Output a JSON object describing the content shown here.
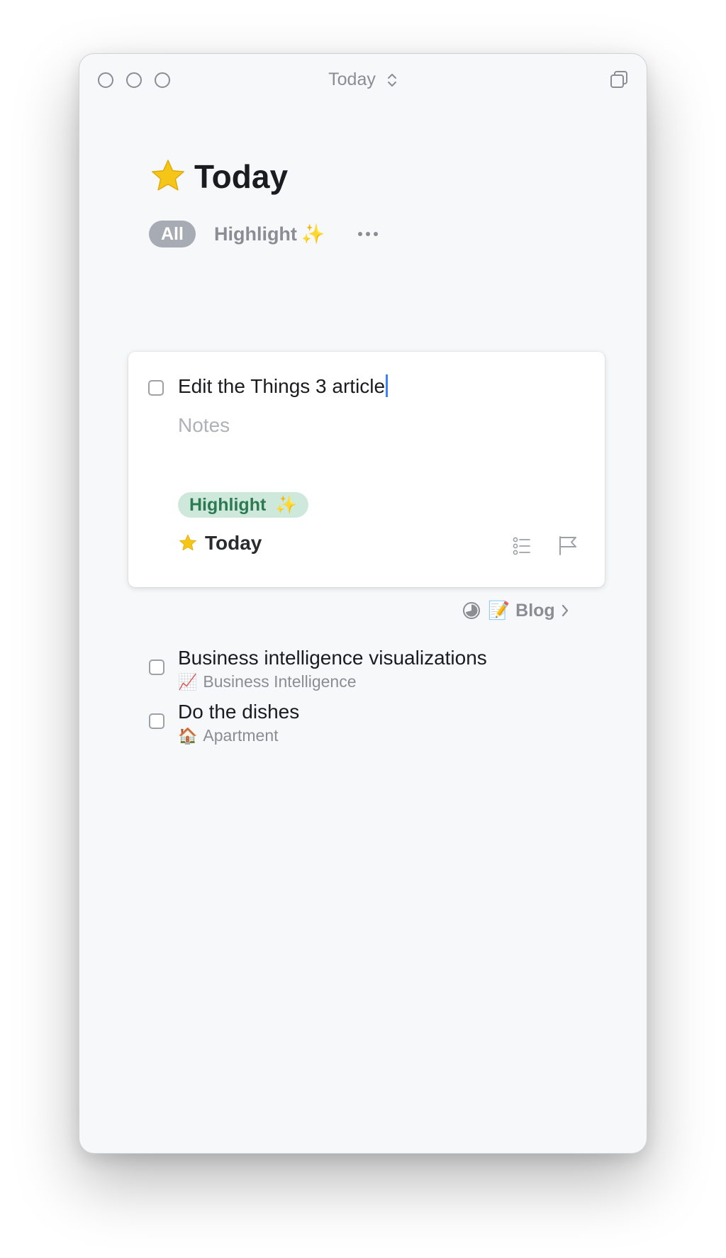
{
  "window": {
    "title": "Today"
  },
  "page": {
    "title": "Today",
    "icon": "star-icon"
  },
  "tag_filter": {
    "all_label": "All",
    "highlight_label": "Highlight",
    "highlight_emoji": "✨",
    "more_icon": "ellipsis-icon"
  },
  "editing_task": {
    "title": "Edit the Things 3 article",
    "notes_placeholder": "Notes",
    "tag_label": "Highlight",
    "tag_emoji": "✨",
    "when_label": "Today",
    "checklist_icon": "checklist-icon",
    "deadline_icon": "flag-icon"
  },
  "project_link": {
    "progress_icon": "project-progress-icon",
    "emoji": "📝",
    "label": "Blog",
    "chevron_icon": "chevron-right-icon"
  },
  "tasks": [
    {
      "title": "Business intelligence visualizations",
      "area_emoji": "📈",
      "area": "Business Intelligence"
    },
    {
      "title": "Do the dishes",
      "area_emoji": "🏠",
      "area": "Apartment"
    }
  ],
  "colors": {
    "accent": "#3b82f6",
    "star": "#f5c518",
    "tag_bg": "#cfe8dc",
    "tag_text": "#2c7a52",
    "muted": "#8a8d94"
  }
}
